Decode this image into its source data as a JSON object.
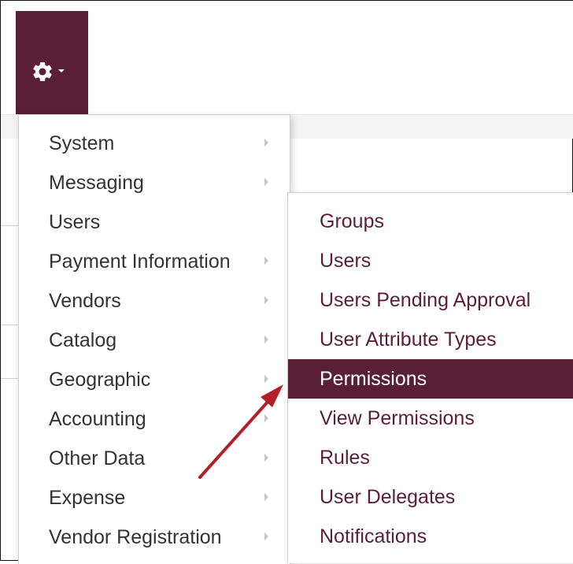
{
  "toolbar": {
    "settings_icon": "gear-icon",
    "dropdown_icon": "caret-down-icon",
    "accent_color": "#5a1f37"
  },
  "menu": {
    "items": [
      {
        "label": "System"
      },
      {
        "label": "Messaging"
      },
      {
        "label": "Users"
      },
      {
        "label": "Payment Information"
      },
      {
        "label": "Vendors"
      },
      {
        "label": "Catalog"
      },
      {
        "label": "Geographic"
      },
      {
        "label": "Accounting"
      },
      {
        "label": "Other Data"
      },
      {
        "label": "Expense"
      },
      {
        "label": "Vendor Registration"
      }
    ]
  },
  "submenu": {
    "parent": "Users",
    "active": "Permissions",
    "items": [
      {
        "label": "Groups"
      },
      {
        "label": "Users"
      },
      {
        "label": "Users Pending Approval"
      },
      {
        "label": "User Attribute Types"
      },
      {
        "label": "Permissions"
      },
      {
        "label": "View Permissions"
      },
      {
        "label": "Rules"
      },
      {
        "label": "User Delegates"
      },
      {
        "label": "Notifications"
      }
    ]
  },
  "annotation": {
    "arrow_color": "#b22027"
  }
}
